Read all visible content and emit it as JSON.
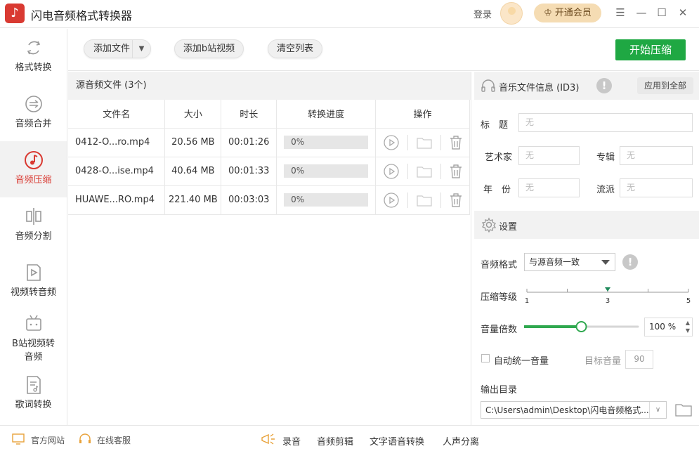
{
  "app": {
    "title": "闪电音频格式转换器",
    "logo_glyph": "♪"
  },
  "account": {
    "login_label": "登录",
    "vip_label": "开通会员"
  },
  "window_controls": {
    "menu": "☰",
    "minimize": "—",
    "maximize": "☐",
    "close": "✕"
  },
  "sidebar": {
    "items": [
      {
        "label": "格式转换",
        "icon": "refresh-icon",
        "active": false
      },
      {
        "label": "音频合并",
        "icon": "merge-icon",
        "active": false
      },
      {
        "label": "音频压缩",
        "icon": "music-note-icon",
        "active": true
      },
      {
        "label": "音频分割",
        "icon": "split-icon",
        "active": false
      },
      {
        "label": "视频转音频",
        "icon": "video-icon",
        "active": false
      },
      {
        "label": "B站视频转音频",
        "label_line1": "B站视频转",
        "label_line2": "音频",
        "icon": "bilibili-icon",
        "active": false
      },
      {
        "label": "歌词转换",
        "icon": "lyrics-icon",
        "active": false
      }
    ]
  },
  "toolbar": {
    "add_file": "添加文件",
    "add_bilibili": "添加b站视频",
    "clear_list": "清空列表",
    "start": "开始压缩"
  },
  "file_list": {
    "header": "源音频文件 (3个)",
    "columns": [
      "文件名",
      "大小",
      "时长",
      "转换进度",
      "操作"
    ],
    "rows": [
      {
        "name": "0412-O...ro.mp4",
        "size": "20.56 MB",
        "duration": "00:01:26",
        "progress": "0%"
      },
      {
        "name": "0428-O...ise.mp4",
        "size": "40.64 MB",
        "duration": "00:01:33",
        "progress": "0%"
      },
      {
        "name": "HUAWE...RO.mp4",
        "size": "221.40 MB",
        "duration": "00:03:03",
        "progress": "0%"
      }
    ]
  },
  "id3": {
    "title": "音乐文件信息 (ID3)",
    "apply_all": "应用到全部",
    "fields": {
      "title_label": "标　题",
      "title_placeholder": "无",
      "artist_label": "艺术家",
      "artist_placeholder": "无",
      "album_label": "专辑",
      "album_placeholder": "无",
      "year_label": "年　份",
      "year_placeholder": "无",
      "genre_label": "流派",
      "genre_placeholder": "无"
    }
  },
  "settings": {
    "title": "设置",
    "format_label": "音频格式",
    "format_value": "与源音频一致",
    "compression_label": "压缩等级",
    "compression_ticks": [
      "1",
      "3",
      "5"
    ],
    "compression_level": 3,
    "volume_label": "音量倍数",
    "volume_fraction": 0.5,
    "volume_value": "100",
    "volume_unit": "%",
    "auto_volume_label": "自动统一音量",
    "target_volume_label": "目标音量",
    "target_volume_value": "90",
    "output_label": "输出目录",
    "output_path": "C:\\Users\\admin\\Desktop\\闪电音频格式..."
  },
  "bottombar": {
    "website": "官方网站",
    "support": "在线客服",
    "record": "录音",
    "edit": "音频剪辑",
    "tts": "文字语音转换",
    "vocal_sep": "人声分离"
  },
  "colors": {
    "accent": "#d93a32",
    "primary_green": "#1fa843",
    "slider_green": "#2fa84f"
  }
}
